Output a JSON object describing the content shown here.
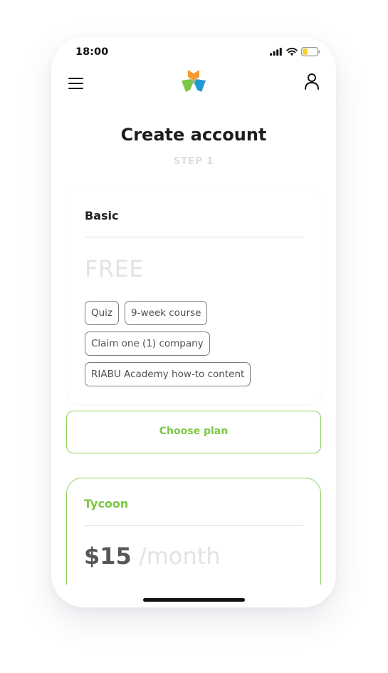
{
  "status_bar": {
    "time": "18:00",
    "icons": [
      "signal-icon",
      "wifi-icon",
      "battery-icon"
    ]
  },
  "nav": {
    "menu_icon": "hamburger-menu-icon",
    "logo_icon": "star-logo-icon",
    "user_icon": "user-profile-icon"
  },
  "page": {
    "title": "Create account",
    "step": "STEP 1"
  },
  "plans": {
    "basic": {
      "name": "Basic",
      "price": "FREE",
      "features": [
        "Quiz",
        "9-week course",
        "Claim one (1) company",
        "RIABU Academy how-to content"
      ]
    },
    "choose_label": "Choose plan",
    "tycoon": {
      "name": "Tycoon",
      "price_amount": "$15",
      "price_period": "/month"
    }
  },
  "colors": {
    "accent_green": "#7cc744",
    "logo_orange": "#f59a34",
    "logo_green": "#7cc744",
    "logo_blue": "#1f9ad6"
  }
}
